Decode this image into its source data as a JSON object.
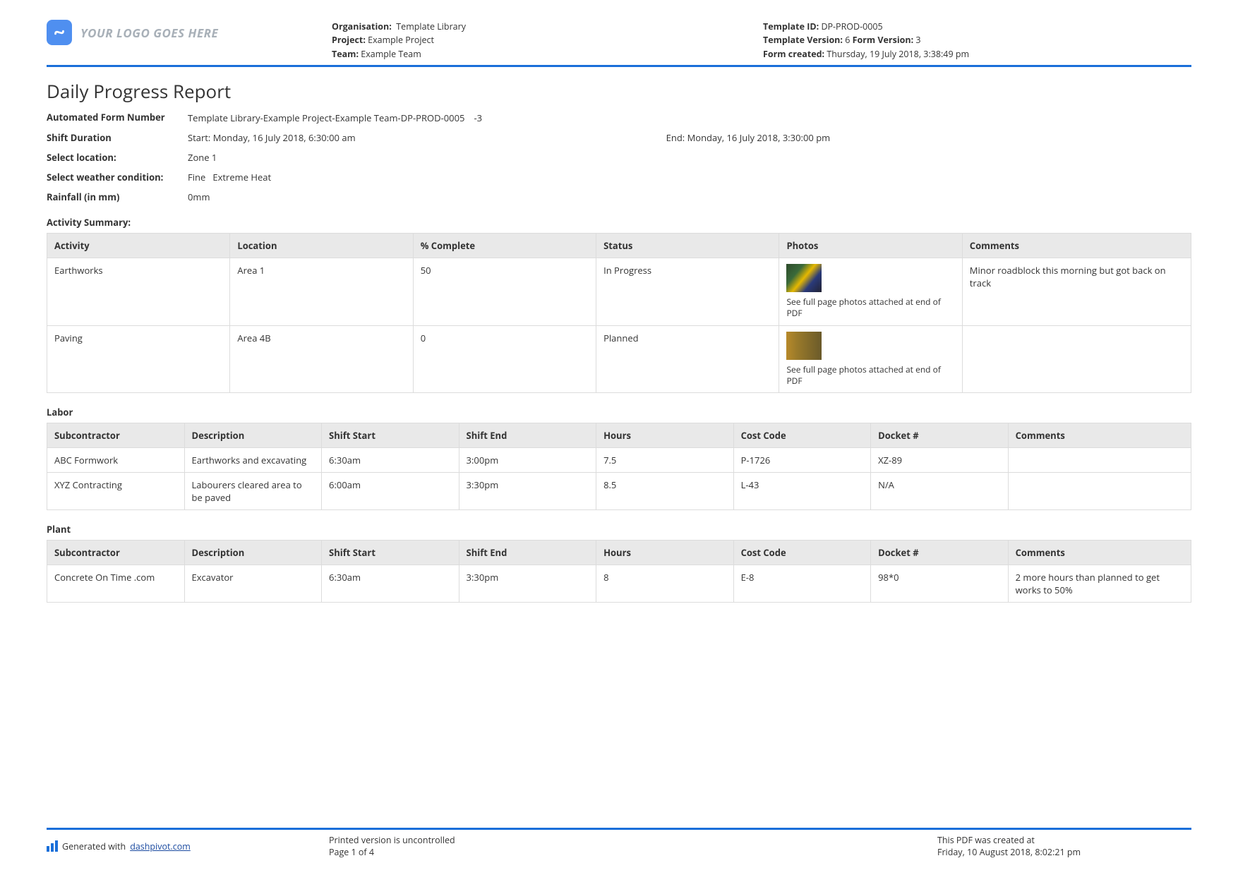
{
  "header": {
    "logo_text": "YOUR LOGO GOES HERE",
    "org_label": "Organisation:",
    "org_val": "Template Library",
    "proj_label": "Project:",
    "proj_val": "Example Project",
    "team_label": "Team:",
    "team_val": "Example Team",
    "tid_label": "Template ID:",
    "tid_val": "DP-PROD-0005",
    "tver_label": "Template Version:",
    "tver_val": "6",
    "fver_label": "Form Version:",
    "fver_val": "3",
    "fcreated_label": "Form created:",
    "fcreated_val": "Thursday, 19 July 2018, 3:38:49 pm"
  },
  "title": "Daily Progress Report",
  "fields": {
    "afn_label": "Automated Form Number",
    "afn_val": "Template Library-Example Project-Example Team-DP-PROD-0005　-3",
    "shift_label": "Shift Duration",
    "shift_start": "Start: Monday, 16 July 2018, 6:30:00 am",
    "shift_end": "End: Monday, 16 July 2018, 3:30:00 pm",
    "loc_label": "Select location:",
    "loc_val": "Zone 1",
    "weather_label": "Select weather condition:",
    "weather_val": "Fine   Extreme Heat",
    "rain_label": "Rainfall (in mm)",
    "rain_val": "0mm"
  },
  "activity": {
    "title": "Activity Summary:",
    "headers": [
      "Activity",
      "Location",
      "% Complete",
      "Status",
      "Photos",
      "Comments"
    ],
    "photo_note": "See full page photos attached at end of PDF",
    "rows": [
      {
        "activity": "Earthworks",
        "location": "Area 1",
        "pct": "50",
        "status": "In Progress",
        "comments": "Minor roadblock this morning but got back on track"
      },
      {
        "activity": "Paving",
        "location": "Area 4B",
        "pct": "0",
        "status": "Planned",
        "comments": ""
      }
    ]
  },
  "labor": {
    "title": "Labor",
    "headers": [
      "Subcontractor",
      "Description",
      "Shift Start",
      "Shift End",
      "Hours",
      "Cost Code",
      "Docket #",
      "Comments"
    ],
    "rows": [
      {
        "sub": "ABC Formwork",
        "desc": "Earthworks and excavating",
        "start": "6:30am",
        "end": "3:00pm",
        "hours": "7.5",
        "cost": "P-1726",
        "docket": "XZ-89",
        "comments": ""
      },
      {
        "sub": "XYZ Contracting",
        "desc": "Labourers cleared area to be paved",
        "start": "6:00am",
        "end": "3:30pm",
        "hours": "8.5",
        "cost": "L-43",
        "docket": "N/A",
        "comments": ""
      }
    ]
  },
  "plant": {
    "title": "Plant",
    "headers": [
      "Subcontractor",
      "Description",
      "Shift Start",
      "Shift End",
      "Hours",
      "Cost Code",
      "Docket #",
      "Comments"
    ],
    "rows": [
      {
        "sub": "Concrete On Time .com",
        "desc": "Excavator",
        "start": "6:30am",
        "end": "3:30pm",
        "hours": "8",
        "cost": "E-8",
        "docket": "98*0",
        "comments": "2 more hours than planned to get works to 50%"
      }
    ]
  },
  "footer": {
    "gen_prefix": "Generated with ",
    "gen_link": "dashpivot.com",
    "uncontrolled": "Printed version is uncontrolled",
    "pageof": "Page 1 of 4",
    "created_at_label": "This PDF was created at",
    "created_at_val": "Friday, 10 August 2018, 8:02:21 pm"
  }
}
